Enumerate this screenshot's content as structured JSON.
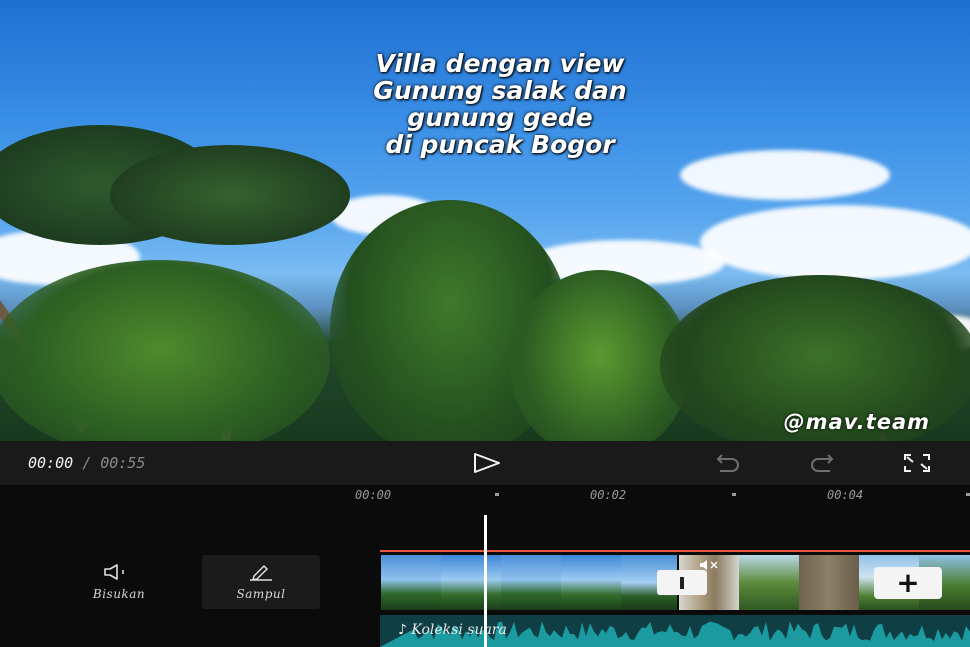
{
  "preview": {
    "title_lines": [
      "Villa dengan view",
      "Gunung salak dan",
      "gunung gede",
      "di puncak Bogor"
    ],
    "watermark": "@mav.team"
  },
  "transport": {
    "current_time": "00:00",
    "separator": "/",
    "duration": "00:55",
    "play_icon": "play-icon",
    "undo_icon": "undo-icon",
    "redo_icon": "redo-icon",
    "fullscreen_icon": "fullscreen-icon"
  },
  "timeline": {
    "ruler": [
      "00:00",
      "00:02",
      "00:04"
    ],
    "tools": {
      "mute_label": "Bisukan",
      "cover_label": "Sampul"
    },
    "audio_label": "Koleksi suara",
    "add_icon": "+",
    "accent_color": "#e85a40",
    "audio_color": "#1b9aa0"
  }
}
